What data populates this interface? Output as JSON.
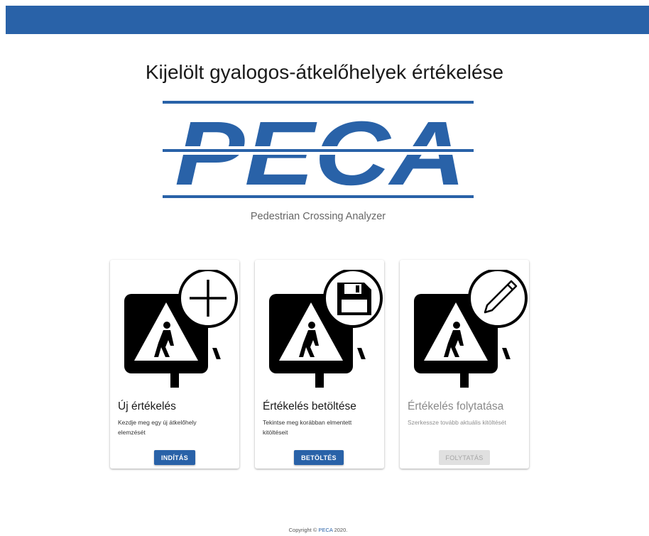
{
  "header": {
    "color": "#2962a8"
  },
  "title": "Kijelölt gyalogos-átkelőhelyek értékelése",
  "logo": {
    "text": "PECA",
    "color": "#2962a8"
  },
  "subtitle": "Pedestrian Crossing Analyzer",
  "cards": [
    {
      "title": "Új értékelés",
      "description": "Kezdje meg egy új átkelőhely elemzését",
      "button": "INDÍTÁS",
      "badge_icon": "plus-icon",
      "enabled": true
    },
    {
      "title": "Értékelés betöltése",
      "description": "Tekintse meg korábban elmentett kitöltéseit",
      "button": "BETÖLTÉS",
      "badge_icon": "floppy-disk-icon",
      "enabled": true
    },
    {
      "title": "Értékelés folytatása",
      "description": "Szerkessze tovább aktuális kitöltését",
      "button": "FOLYTATÁS",
      "badge_icon": "pencil-icon",
      "enabled": false
    }
  ],
  "footer": {
    "prefix": "Copyright ©",
    "link": "PECA",
    "suffix": "2020."
  }
}
